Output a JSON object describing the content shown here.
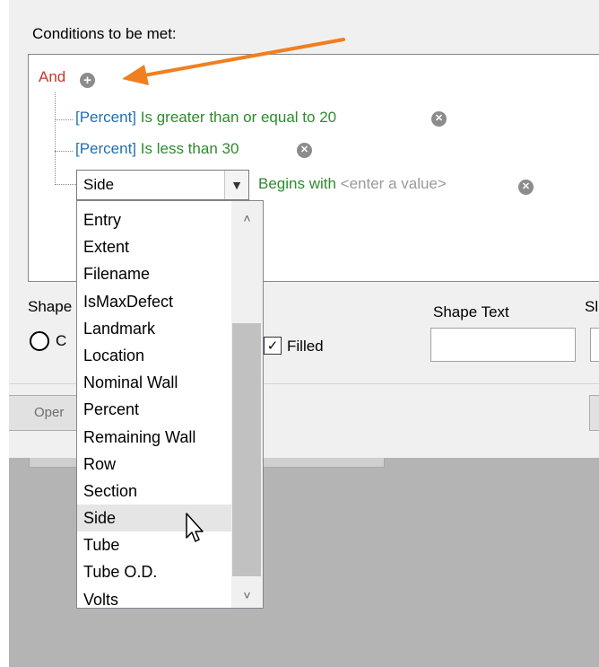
{
  "conditions_label": "Conditions to be met:",
  "logic": {
    "operator": "And",
    "add_icon": "plus-circle-icon"
  },
  "conditions": [
    {
      "field": "[Percent]",
      "operator": "Is greater than or equal to",
      "value": "20",
      "remove_icon": "x-circle-icon"
    },
    {
      "field": "[Percent]",
      "operator": "Is less than",
      "value": "30",
      "remove_icon": "x-circle-icon"
    }
  ],
  "editing": {
    "field_value": "Side",
    "operator": "Begins with",
    "placeholder": "<enter a value>",
    "remove_icon": "x-circle-icon"
  },
  "dropdown": {
    "items": [
      "Entry",
      "Extent",
      "Filename",
      "IsMaxDefect",
      "Landmark",
      "Location",
      "Nominal Wall",
      "Percent",
      "Remaining Wall",
      "Row",
      "Section",
      "Side",
      "Tube",
      "Tube O.D.",
      "Volts"
    ],
    "selected": "Side",
    "scroll_up_icon": "chevron-up-icon",
    "scroll_down_icon": "chevron-down-icon"
  },
  "shape": {
    "label": "Shape",
    "radio_label": "C",
    "filled_label": "Filled",
    "filled_checked": true,
    "checkmark": "✓",
    "text_label": "Shape Text",
    "truncated_label": "Sl"
  },
  "footer": {
    "open_button": "Oper"
  },
  "colors": {
    "and": "#c0392b",
    "field": "#1f6fb2",
    "operator": "#2e8b2e",
    "placeholder": "#9a9a9a",
    "annotation_arrow": "#f07f1f"
  }
}
